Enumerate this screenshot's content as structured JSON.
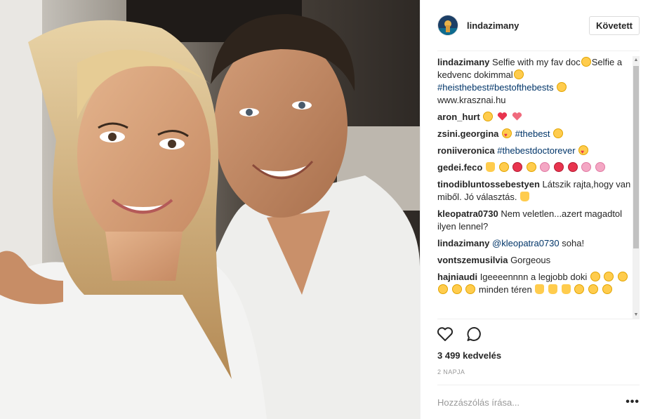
{
  "post": {
    "username": "lindazimany",
    "follow_label": "Követett"
  },
  "comments": [
    {
      "user": "lindazimany",
      "text": "Selfie with my fav doc",
      "text2": "Selfie a kedvenc dokimmal",
      "tag1": "#heisthebest",
      "tag2": "#bestofthebests",
      "text3": "www.krasznai.hu"
    },
    {
      "user": "aron_hurt",
      "text": ""
    },
    {
      "user": "zsini.georgina",
      "tag": "#thebest"
    },
    {
      "user": "roniiveronica",
      "tag": "#thebestdoctorever"
    },
    {
      "user": "gedei.feco",
      "text": ""
    },
    {
      "user": "tinodibluntossebestyen",
      "text": "Látszik rajta,hogy van miből. Jó választás."
    },
    {
      "user": "kleopatra0730",
      "text": "Nem veletlen...azert magadtol ilyen lennel?"
    },
    {
      "user": "lindazimany",
      "mention": "@kleopatra0730",
      "text": " soha!"
    },
    {
      "user": "vontszemusilvia",
      "text": "Gorgeous"
    },
    {
      "user": "hajniaudi",
      "text": "Igeeeennnn a legjobb doki",
      "text2": "minden téren"
    }
  ],
  "likes_label": "3 499 kedvelés",
  "time_label": "2 NAPJA",
  "add_comment_placeholder": "Hozzászólás írása...",
  "icons": {
    "like": "heart-outline-icon",
    "comment": "speech-bubble-icon",
    "more": "more-options-icon"
  },
  "colors": {
    "hashtag": "#003569",
    "username": "#262626",
    "muted": "#999999"
  }
}
